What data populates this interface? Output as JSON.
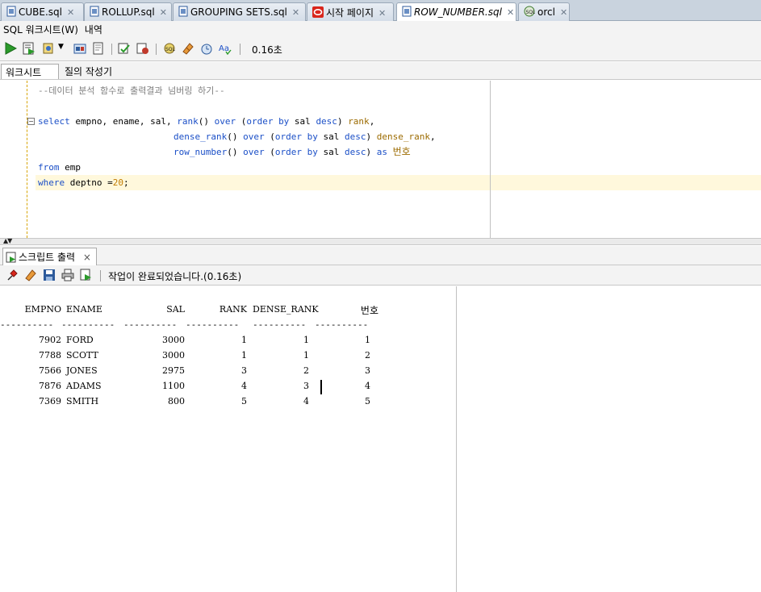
{
  "tabs": [
    {
      "label": "CUBE.sql",
      "icon": "sql-file-icon",
      "close": "✕"
    },
    {
      "label": "ROLLUP.sql",
      "icon": "sql-file-icon",
      "close": "✕"
    },
    {
      "label": "GROUPING SETS.sql",
      "icon": "sql-file-icon",
      "close": "✕"
    },
    {
      "label": "시작 페이지",
      "icon": "oracle-icon",
      "close": "✕"
    },
    {
      "label": "ROW_NUMBER.sql",
      "icon": "sql-file-icon",
      "close": "✕"
    },
    {
      "label": "orcl",
      "icon": "connection-icon",
      "close": "✕"
    }
  ],
  "worksheet_header": {
    "title": "SQL 워크시트(W)",
    "history": "내역"
  },
  "toolbar": {
    "elapsed": "0.16초"
  },
  "subtabs": {
    "worksheet": "워크시트",
    "query_builder": "질의 작성기"
  },
  "editor": {
    "comment": "--데이터 분석 함수로 출력결과 넘버링 하기--",
    "line_select": [
      "select",
      " empno, ename, sal, ",
      "rank",
      "() ",
      "over",
      " (",
      "order by",
      " sal ",
      "desc",
      ") ",
      "rank",
      ","
    ],
    "line_dense": [
      "dense_rank",
      "() ",
      "over",
      " (",
      "order by",
      " sal ",
      "desc",
      ") ",
      "dense_rank",
      ","
    ],
    "line_rownum": [
      "row_number",
      "() ",
      "over",
      " (",
      "order by",
      " sal ",
      "desc",
      ") ",
      "as",
      " ",
      "번호"
    ],
    "line_from": [
      "from",
      " emp"
    ],
    "line_where": [
      "where",
      " deptno =",
      "20",
      ";"
    ]
  },
  "output": {
    "tab_label": "스크립트 출력",
    "tab_close": "×",
    "message": "작업이 완료되었습니다.(0.16초)",
    "columns": [
      "EMPNO",
      "ENAME",
      "SAL",
      "RANK",
      "DENSE_RANK",
      "번호"
    ],
    "dashes": "----------",
    "rows": [
      [
        "7902",
        "FORD",
        "3000",
        "1",
        "1",
        "1"
      ],
      [
        "7788",
        "SCOTT",
        "3000",
        "1",
        "1",
        "2"
      ],
      [
        "7566",
        "JONES",
        "2975",
        "3",
        "2",
        "3"
      ],
      [
        "7876",
        "ADAMS",
        "1100",
        "4",
        "3",
        "4"
      ],
      [
        "7369",
        "SMITH",
        "800",
        "5",
        "4",
        "5"
      ]
    ]
  },
  "colors": {
    "keyword": "#1b4fc7",
    "comment": "#808080",
    "tabbar": "#c9d3de",
    "highlight": "#fff8dc"
  }
}
